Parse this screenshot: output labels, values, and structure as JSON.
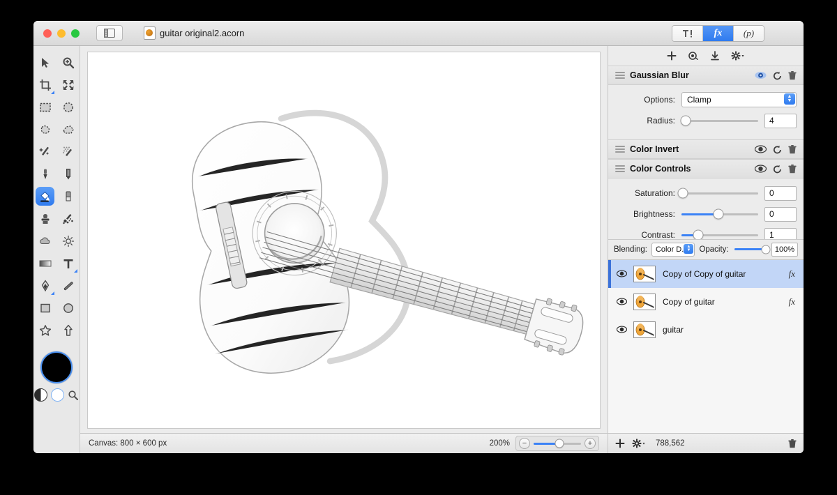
{
  "window": {
    "document_title": "guitar original2.acorn",
    "traffic_lights": [
      "close",
      "minimize",
      "zoom"
    ],
    "sidebar_toggle": "sidebar-toggle"
  },
  "inspector_tabs": [
    {
      "id": "tools",
      "label": "",
      "icon": "hammer-icon",
      "active": false
    },
    {
      "id": "filters",
      "label": "fx",
      "icon": "fx-icon",
      "active": true
    },
    {
      "id": "palette",
      "label": "(p)",
      "icon": "palette-icon",
      "active": false
    }
  ],
  "inspector_actions": [
    {
      "name": "add-filter-icon",
      "glyph": "+"
    },
    {
      "name": "preset-icon",
      "glyph": "◎"
    },
    {
      "name": "download-icon",
      "glyph": "⤓"
    },
    {
      "name": "gear-menu-icon",
      "glyph": "⚙"
    }
  ],
  "filters": [
    {
      "title": "Gaussian Blur",
      "visible": true,
      "eye_active": true,
      "rows": [
        {
          "type": "popup",
          "label": "Options:",
          "value": "Clamp"
        },
        {
          "type": "slider",
          "label": "Radius:",
          "value": "4",
          "fill_pct": 5,
          "thumb_pct": 5
        }
      ]
    },
    {
      "title": "Color Invert",
      "visible": true,
      "eye_active": false,
      "rows": []
    },
    {
      "title": "Color Controls",
      "visible": true,
      "eye_active": false,
      "rows": [
        {
          "type": "slider",
          "label": "Saturation:",
          "value": "0",
          "fill_pct": 0,
          "thumb_pct": 2
        },
        {
          "type": "slider",
          "label": "Brightness:",
          "value": "0",
          "fill_pct": 48,
          "thumb_pct": 48
        },
        {
          "type": "slider",
          "label": "Contrast:",
          "value": "1",
          "fill_pct": 22,
          "thumb_pct": 22
        }
      ]
    }
  ],
  "blending": {
    "label": "Blending:",
    "value": "Color D...",
    "opacity_label": "Opacity:",
    "opacity_value": "100%",
    "opacity_pct": 100
  },
  "layers": [
    {
      "name": "Copy of Copy of guitar",
      "visible": true,
      "selected": true,
      "has_fx": true,
      "fx_label": "fx"
    },
    {
      "name": "Copy of guitar",
      "visible": true,
      "selected": false,
      "has_fx": true,
      "fx_label": "fx"
    },
    {
      "name": "guitar",
      "visible": true,
      "selected": false,
      "has_fx": false,
      "fx_label": ""
    }
  ],
  "layer_bottom": {
    "add": "+",
    "gear": "⚙",
    "count": "788,562",
    "delete": "trash-icon"
  },
  "status": {
    "canvas": "Canvas: 800 × 600 px",
    "zoom": "200%",
    "zoom_pct": 55,
    "zoom_out": "−",
    "zoom_in": "+"
  },
  "tools": [
    {
      "name": "move-tool",
      "icon": "arrow-cursor-icon",
      "selected": false
    },
    {
      "name": "zoom-tool",
      "icon": "magnifier-plus-icon",
      "selected": false
    },
    {
      "name": "crop-tool",
      "icon": "crop-icon",
      "selected": false,
      "submenu": true
    },
    {
      "name": "transform-tool",
      "icon": "arrows-expand-icon",
      "selected": false
    },
    {
      "name": "rect-select-tool",
      "icon": "rectangle-marquee-icon",
      "selected": false
    },
    {
      "name": "ellipse-select-tool",
      "icon": "ellipse-marquee-icon",
      "selected": false
    },
    {
      "name": "lasso-tool",
      "icon": "lasso-icon",
      "selected": false
    },
    {
      "name": "polygon-lasso-tool",
      "icon": "polygon-lasso-icon",
      "selected": false
    },
    {
      "name": "magic-wand-tool",
      "icon": "magic-wand-icon",
      "selected": false
    },
    {
      "name": "instant-alpha-tool",
      "icon": "magic-wand-dots-icon",
      "selected": false
    },
    {
      "name": "eyedropper-tool",
      "icon": "eyedropper-icon",
      "selected": false
    },
    {
      "name": "pencil-tool",
      "icon": "pencil-icon",
      "selected": false
    },
    {
      "name": "paint-bucket-tool",
      "icon": "paint-bucket-icon",
      "selected": true
    },
    {
      "name": "eraser-tool",
      "icon": "eraser-icon",
      "selected": false
    },
    {
      "name": "clone-stamp-tool",
      "icon": "stamp-icon",
      "selected": false
    },
    {
      "name": "smudge-tool",
      "icon": "smudge-splatter-icon",
      "selected": false
    },
    {
      "name": "blur-tool",
      "icon": "cloud-icon",
      "selected": false
    },
    {
      "name": "dodge-tool",
      "icon": "sun-icon",
      "selected": false
    },
    {
      "name": "gradient-tool",
      "icon": "gradient-icon",
      "selected": false
    },
    {
      "name": "text-tool",
      "icon": "text-t-icon",
      "selected": false,
      "submenu": true
    },
    {
      "name": "pen-tool",
      "icon": "pen-nib-icon",
      "selected": false,
      "submenu": true
    },
    {
      "name": "line-tool",
      "icon": "line-icon",
      "selected": false
    },
    {
      "name": "rectangle-shape-tool",
      "icon": "square-icon",
      "selected": false
    },
    {
      "name": "ellipse-shape-tool",
      "icon": "circle-icon",
      "selected": false
    },
    {
      "name": "star-shape-tool",
      "icon": "star-icon",
      "selected": false
    },
    {
      "name": "arrow-shape-tool",
      "icon": "arrow-up-icon",
      "selected": false
    }
  ],
  "colors": {
    "foreground": "#000000",
    "accent": "#3b82f6",
    "selection": "#c2d6f7"
  }
}
